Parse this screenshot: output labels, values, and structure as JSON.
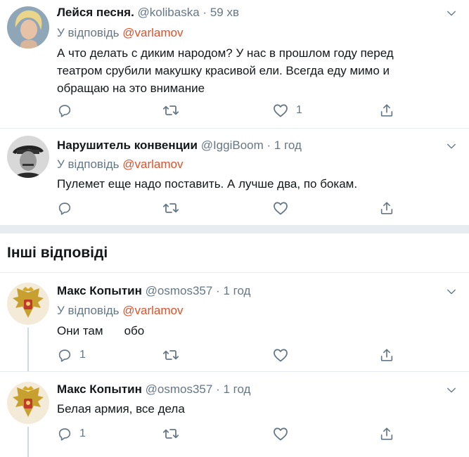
{
  "tweets_top": [
    {
      "name": "Лейся песня.",
      "handle": "@kolibaska",
      "dot": "·",
      "time": "59 хв",
      "reply_prefix": "У відповідь",
      "reply_mention": "@varlamov",
      "text_lines": [
        "А что делать с диким народом? У нас в прошлом году перед",
        "театром срубили макушку красивой ели. Всегда еду мимо и",
        "обращаю на это внимание"
      ],
      "reply_count": "",
      "retweet_count": "",
      "like_count": "1"
    },
    {
      "name": "Нарушитель конвенции",
      "handle": "@IggiBoom",
      "dot": "·",
      "time": "1 год",
      "reply_prefix": "У відповідь",
      "reply_mention": "@varlamov",
      "text_lines": [
        "Пулемет еще надо поставить. А лучше два, по бокам."
      ],
      "reply_count": "",
      "retweet_count": "",
      "like_count": ""
    }
  ],
  "other_replies_title": "Інші відповіді",
  "tweets_other": [
    {
      "name": "Макс Копытин",
      "handle": "@osmos357",
      "dot": "·",
      "time": "1 год",
      "reply_prefix": "У відповідь",
      "reply_mention": "@varlamov",
      "text_lines": [
        "Они там",
        "обо"
      ],
      "reply_count": "1",
      "retweet_count": "",
      "like_count": ""
    },
    {
      "name": "Макс Копытин",
      "handle": "@osmos357",
      "dot": "·",
      "time": "1 год",
      "text_lines": [
        "Белая армия, все дела"
      ],
      "reply_count": "1",
      "retweet_count": "",
      "like_count": ""
    }
  ],
  "icons": {
    "reply": "reply-icon",
    "retweet": "retweet-icon",
    "like": "heart-icon",
    "share": "share-icon",
    "more": "chevron-down-icon"
  },
  "colors": {
    "mention": "#e0502a",
    "secondary_text": "#657786",
    "divider": "#e6ecf0"
  }
}
